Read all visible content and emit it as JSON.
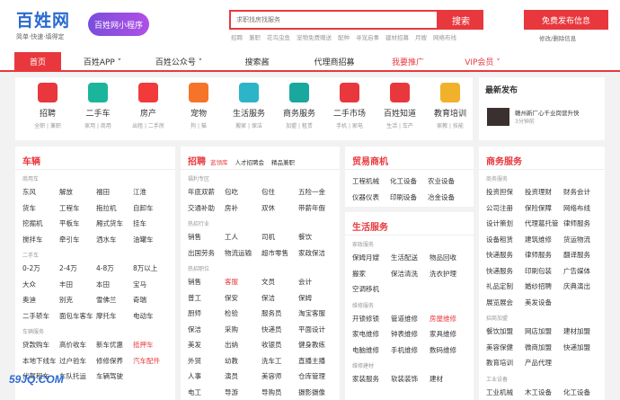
{
  "header": {
    "logo": "百姓网",
    "logo_sub": "简单·快速·填得定",
    "mini_program": "百姓网小程序",
    "search_placeholder": "求职找房找服务",
    "search_button": "搜索",
    "hot_words": [
      "招聘",
      "兼职",
      "花鸟虫鱼",
      "宠物免费赠送",
      "配种",
      "寻宠启事",
      "建材招募",
      "月嫂",
      "网络布线"
    ],
    "post_button": "免费发布信息",
    "post_sub": "修改/删除信息"
  },
  "nav": [
    {
      "label": "首页",
      "active": true
    },
    {
      "label": "百姓APP ˅"
    },
    {
      "label": "百姓公众号 ˅"
    },
    {
      "label": "搜索酱"
    },
    {
      "label": "代理商招募"
    },
    {
      "label": "我要推广",
      "red": true
    },
    {
      "label": "VIP会员 ˅",
      "red": true
    }
  ],
  "categories": [
    {
      "name": "招聘",
      "sub": "全职 | 兼职",
      "color": "#e8383d",
      "icon": "briefcase-icon"
    },
    {
      "name": "二手车",
      "sub": "家用 | 商用",
      "color": "#1ab59a",
      "icon": "car-icon"
    },
    {
      "name": "房产",
      "sub": "出租 | 二手房",
      "color": "#f23a3a",
      "icon": "house-icon"
    },
    {
      "name": "宠物",
      "sub": "狗 | 猫",
      "color": "#f5742a",
      "icon": "pet-icon"
    },
    {
      "name": "生活服务",
      "sub": "搬家 | 保洁",
      "color": "#2cb5c8",
      "icon": "person-icon"
    },
    {
      "name": "商务服务",
      "sub": "加盟 | 租赁",
      "color": "#1aa89e",
      "icon": "bag-icon"
    },
    {
      "name": "二手市场",
      "sub": "手机 | 家电",
      "color": "#e8383d",
      "icon": "cart-icon"
    },
    {
      "name": "百姓知道",
      "sub": "生活 | 车产",
      "color": "#e8383d",
      "icon": "scholar-icon"
    },
    {
      "name": "教育培训",
      "sub": "家教 | 技能",
      "color": "#f2b12a",
      "icon": "cap-icon"
    }
  ],
  "release": {
    "title": "最新发布",
    "text": "赣州新厂心千业岗营升快",
    "time": "3分钟前"
  },
  "columns": {
    "vehicle": {
      "title": "车辆",
      "sections": [
        {
          "label": "商用车",
          "rows": [
            [
              "东风",
              "解放",
              "福田",
              "江淮"
            ],
            [
              "货车",
              "工程车",
              "拖拉机",
              "自卸车"
            ],
            [
              "挖掘机",
              "平板车",
              "厢式货车",
              "挂车"
            ],
            [
              "搅拌车",
              "牵引车",
              "洒水车",
              "油罐车"
            ]
          ]
        },
        {
          "label": "二手车",
          "rows": [
            [
              "0-2万",
              "2-4万",
              "4-8万",
              "8万以上"
            ],
            [
              "大众",
              "丰田",
              "本田",
              "宝马"
            ],
            [
              "奥迪",
              "别克",
              "雪佛兰",
              "奇瑞"
            ],
            [
              "二手轿车",
              "面包车客车",
              "摩托车",
              "电动车"
            ]
          ]
        },
        {
          "label": "车辆服务",
          "rows": [
            [
              "贷款购车",
              "高价收车",
              "新车优惠",
              "抵押车"
            ],
            [
              "本地下线车",
              "过户验车",
              "修修保养",
              "汽车配件"
            ],
            [
              "代驾租车",
              "车队托运",
              "车辆驾驶",
              ""
            ]
          ]
        }
      ]
    },
    "recruit": {
      "title": "招聘",
      "tab1": "蓝领库",
      "tab2": "人才招聘会",
      "tab3": "精品兼职",
      "sections": [
        {
          "label": "福利专区",
          "rows": [
            [
              "年底双薪",
              "包吃",
              "包住",
              "五险一金"
            ],
            [
              "交通补助",
              "房补",
              "双休",
              "带薪年假"
            ]
          ]
        },
        {
          "label": "热招行业",
          "rows": [
            [
              "销售",
              "工人",
              "司机",
              "餐饮"
            ],
            [
              "出国劳务",
              "物流运输",
              "超市零售",
              "家政保洁"
            ]
          ]
        },
        {
          "label": "热招职位",
          "rows": [
            [
              "销售",
              "客服",
              "文员",
              "会计"
            ],
            [
              "普工",
              "保安",
              "保洁",
              "保姆"
            ],
            [
              "厨师",
              "检验",
              "服务员",
              "淘宝客服"
            ],
            [
              "保洁",
              "采购",
              "快递员",
              "平面设计"
            ],
            [
              "美发",
              "出纳",
              "收银员",
              "健身教练"
            ],
            [
              "外贸",
              "幼教",
              "洗车工",
              "直播主播"
            ],
            [
              "人事",
              "演员",
              "美容师",
              "仓库管理"
            ],
            [
              "电工",
              "导游",
              "导购员",
              "摄影摄像"
            ]
          ]
        }
      ]
    },
    "trade": {
      "title": "贸易商机",
      "rows": [
        [
          "工程机械",
          "化工设备",
          "农业设备"
        ],
        [
          "仪器仪表",
          "印刷设备",
          "冶金设备"
        ]
      ]
    },
    "life": {
      "title": "生活服务",
      "sections": [
        {
          "label": "家政服务",
          "rows": [
            [
              "保姆月嫂",
              "生活配送",
              "物品回收"
            ],
            [
              "搬家",
              "保洁清洗",
              "洗衣护理"
            ],
            [
              "空调移机",
              "",
              ""
            ]
          ]
        },
        {
          "label": "维修服务",
          "rows": [
            [
              "开锁修锁",
              "管道维修",
              "房屋维修"
            ],
            [
              "家电维修",
              "钟表维修",
              "家具维修"
            ],
            [
              "电脑维修",
              "手机维修",
              "数码维修"
            ]
          ]
        },
        {
          "label": "维修建材",
          "rows": [
            [
              "家装服务",
              "软装装饰",
              "建材"
            ]
          ]
        }
      ]
    },
    "business": {
      "title": "商务服务",
      "sections": [
        {
          "label": "商务服务",
          "rows": [
            [
              "投资担保",
              "投资理财",
              "财务会计"
            ],
            [
              "公司注册",
              "保险保障",
              "网络布线"
            ],
            [
              "设计策划",
              "代理葛托管",
              "律师服务"
            ],
            [
              "设备租赁",
              "建筑维修",
              "货运物流"
            ],
            [
              "快递服务",
              "律师服务",
              "翻译服务"
            ],
            [
              "快递服务",
              "印刷包装",
              "广告媒体"
            ],
            [
              "礼品定制",
              "婚纱招聘",
              "庆典演出"
            ],
            [
              "展览展会",
              "美发设备",
              ""
            ]
          ]
        },
        {
          "label": "招商加盟",
          "rows": [
            [
              "餐饮加盟",
              "网店加盟",
              "建材加盟"
            ],
            [
              "美容保健",
              "微商加盟",
              "快递加盟"
            ],
            [
              "教育培训",
              "产品代理",
              ""
            ]
          ]
        },
        {
          "label": "工业设备",
          "rows": [
            [
              "工业机械",
              "木工设备",
              "化工设备"
            ]
          ]
        }
      ]
    }
  },
  "watermark": "59JQ.COM"
}
